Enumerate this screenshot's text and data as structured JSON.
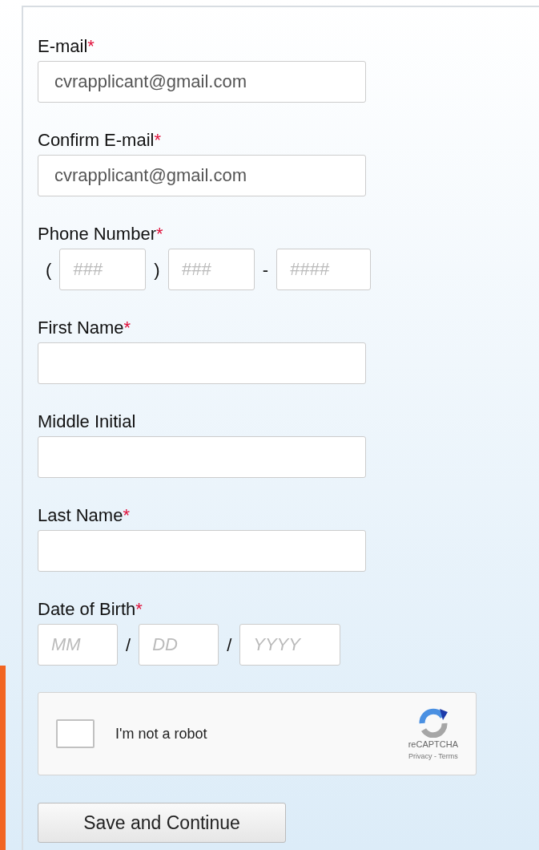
{
  "fields": [
    {
      "kind": "text",
      "label": "E-mail",
      "required_mark": "*",
      "value": "cvrapplicant@gmail.com"
    },
    {
      "kind": "text",
      "label": "Confirm E-mail",
      "required_mark": "*",
      "value": "cvrapplicant@gmail.com"
    },
    {
      "kind": "phone",
      "label": "Phone Number",
      "required_mark": "*",
      "parts": [
        {
          "before": "(",
          "placeholder": "###"
        },
        {
          "before": ")",
          "placeholder": "###"
        },
        {
          "before": "-",
          "placeholder": "####"
        }
      ]
    },
    {
      "kind": "text",
      "label": "First Name",
      "required_mark": "*"
    },
    {
      "kind": "text",
      "label": "Middle Initial"
    },
    {
      "kind": "text",
      "label": "Last Name",
      "required_mark": "*"
    },
    {
      "kind": "date",
      "label": "Date of Birth",
      "required_mark": "*",
      "parts": [
        {
          "placeholder": "MM"
        },
        {
          "before": "/",
          "placeholder": "DD"
        },
        {
          "before": "/",
          "placeholder": "YYYY"
        }
      ]
    }
  ],
  "captcha": {
    "label": "I'm not a robot",
    "checked": false,
    "brand": "reCAPTCHA",
    "links": "Privacy - Terms"
  },
  "submit_button": "Save and Continue"
}
